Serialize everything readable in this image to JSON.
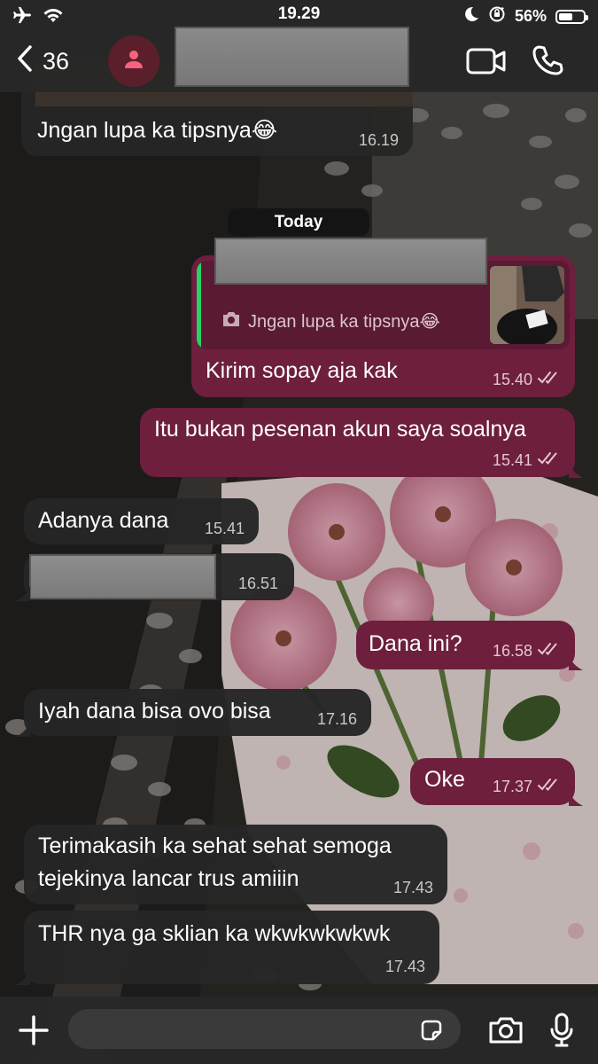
{
  "status_bar": {
    "time": "19.29",
    "battery_percent": "56%",
    "battery_level": 0.56,
    "icons": [
      "airplane-icon",
      "wifi-icon",
      "moon-icon",
      "rotation-lock-icon",
      "battery-icon"
    ]
  },
  "header": {
    "back_label": "36",
    "avatar_icon": "person-icon",
    "actions": [
      "video-call-icon",
      "phone-icon"
    ]
  },
  "chat": {
    "date_divider": "Today",
    "messages": [
      {
        "direction": "in",
        "text": "Jngan lupa ka tipsnya😂",
        "time": "16.19"
      },
      {
        "direction": "out",
        "text": "Kirim sopay aja kak",
        "time": "15.40",
        "status": "read",
        "reply_to": {
          "text": "Jngan lupa ka tipsnya😂",
          "media_icon": "camera-icon"
        }
      },
      {
        "direction": "out",
        "text": "Itu bukan pesenan akun saya soalnya",
        "time": "15.41",
        "status": "read"
      },
      {
        "direction": "in",
        "text": "Adanya dana",
        "time": "15.41"
      },
      {
        "direction": "in",
        "text": "",
        "time": "16.51"
      },
      {
        "direction": "out",
        "text": "Dana ini?",
        "time": "16.58",
        "status": "read"
      },
      {
        "direction": "in",
        "text": "Iyah dana bisa ovo bisa",
        "time": "17.16"
      },
      {
        "direction": "out",
        "text": "Oke",
        "time": "17.37",
        "status": "read"
      },
      {
        "direction": "in",
        "lines": [
          "Terimakasih ka sehat sehat semoga",
          "tejekinya lancar trus amiiin"
        ],
        "time": "17.43"
      },
      {
        "direction": "in",
        "text": "THR nya ga sklian ka wkwkwkwkwk",
        "time": "17.43"
      }
    ]
  },
  "input_bar": {
    "placeholder": "",
    "icons": [
      "plus-icon",
      "sticker-icon",
      "camera-icon",
      "microphone-icon"
    ]
  },
  "colors": {
    "outgoing_bubble": "#6d1f3d",
    "incoming_bubble": "#262626",
    "reply_accent": "#25d366",
    "bar_background": "#282828"
  }
}
